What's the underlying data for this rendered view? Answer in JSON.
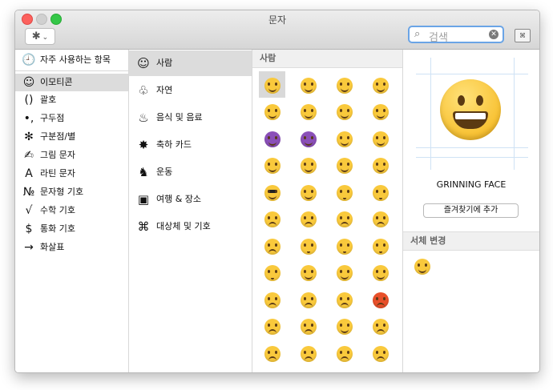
{
  "window": {
    "title": "문자"
  },
  "toolbar": {
    "gear_icon": "gear-icon",
    "search_placeholder": "검색"
  },
  "categories": [
    {
      "icon": "clock-icon",
      "glyph": "🕘",
      "label": "자주 사용하는 항목"
    },
    {
      "icon": "smiley-icon",
      "glyph": "☺",
      "label": "이모티콘"
    },
    {
      "icon": "parentheses-icon",
      "glyph": "()",
      "label": "괄호"
    },
    {
      "icon": "punctuation-icon",
      "glyph": "•,",
      "label": "구두점"
    },
    {
      "icon": "asterisk-icon",
      "glyph": "✻",
      "label": "구분점/별"
    },
    {
      "icon": "pen-icon",
      "glyph": "✍",
      "label": "그림 문자"
    },
    {
      "icon": "latin-a-icon",
      "glyph": "A",
      "label": "라틴 문자"
    },
    {
      "icon": "numero-icon",
      "glyph": "№",
      "label": "문자형 기호"
    },
    {
      "icon": "sqrt-icon",
      "glyph": "√",
      "label": "수학 기호"
    },
    {
      "icon": "dollar-icon",
      "glyph": "$",
      "label": "통화 기호"
    },
    {
      "icon": "arrow-icon",
      "glyph": "→",
      "label": "화살표"
    }
  ],
  "emoji_groups": [
    {
      "icon": "smiley-icon",
      "glyph": "☺",
      "label": "사람"
    },
    {
      "icon": "tree-icon",
      "glyph": "♧",
      "label": "자연"
    },
    {
      "icon": "cake-icon",
      "glyph": "♨",
      "label": "음식 및 음료"
    },
    {
      "icon": "party-popper-icon",
      "glyph": "✸",
      "label": "축하 카드"
    },
    {
      "icon": "runner-icon",
      "glyph": "♞",
      "label": "운동"
    },
    {
      "icon": "car-icon",
      "glyph": "▣",
      "label": "여행 & 장소"
    },
    {
      "icon": "symbols-icon",
      "glyph": "⌘",
      "label": "대상체 및 기호"
    }
  ],
  "section_title": "사람",
  "emoji_grid": [
    [
      "grinning",
      "smile-squint",
      "joy",
      "smiley"
    ],
    [
      "grin",
      "sweat-smile",
      "laughing",
      "innocent"
    ],
    [
      "smiling-imp",
      "imp",
      "wink",
      "blush"
    ],
    [
      "relaxed",
      "yum",
      "relieved",
      "heart-eyes"
    ],
    [
      "sunglasses",
      "smirk",
      "neutral",
      "expressionless"
    ],
    [
      "unamused",
      "cold-sweat",
      "pensive",
      "confused"
    ],
    [
      "confounded",
      "kissing",
      "kissing-heart",
      "kissing-smiling"
    ],
    [
      "kissing-closed",
      "tongue",
      "tongue-wink",
      "tongue-closed"
    ],
    [
      "disappointed",
      "worried",
      "angry",
      "rage"
    ],
    [
      "cry",
      "persevere",
      "triumph",
      "sad-relieved"
    ],
    [
      "frowning",
      "anguished",
      "fearful",
      "weary"
    ]
  ],
  "emoji_colors": {
    "face": "#f9c93c",
    "purple": "#8a4fb8",
    "red": "#e8502a"
  },
  "preview": {
    "name": "GRINNING FACE",
    "favorite_label": "즐겨찾기에 추가",
    "variations_title": "서체 변경"
  }
}
